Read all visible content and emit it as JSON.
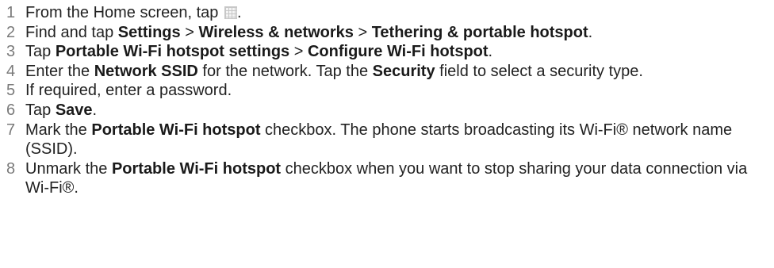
{
  "steps": [
    {
      "num": "1",
      "parts": [
        {
          "t": "From the Home screen, tap "
        },
        {
          "icon": "app-grid-icon"
        },
        {
          "t": "."
        }
      ]
    },
    {
      "num": "2",
      "parts": [
        {
          "t": "Find and tap "
        },
        {
          "b": "Settings"
        },
        {
          "t": " > "
        },
        {
          "b": "Wireless & networks"
        },
        {
          "t": " > "
        },
        {
          "b": "Tethering & portable hotspot"
        },
        {
          "t": "."
        }
      ]
    },
    {
      "num": "3",
      "parts": [
        {
          "t": "Tap "
        },
        {
          "b": "Portable Wi-Fi hotspot settings"
        },
        {
          "t": " > "
        },
        {
          "b": "Configure Wi-Fi hotspot"
        },
        {
          "t": "."
        }
      ]
    },
    {
      "num": "4",
      "parts": [
        {
          "t": "Enter the "
        },
        {
          "b": "Network SSID"
        },
        {
          "t": " for the network. Tap the "
        },
        {
          "b": "Security"
        },
        {
          "t": " field to select a security type."
        }
      ]
    },
    {
      "num": "5",
      "parts": [
        {
          "t": "If required, enter a password."
        }
      ]
    },
    {
      "num": "6",
      "parts": [
        {
          "t": "Tap "
        },
        {
          "b": "Save"
        },
        {
          "t": "."
        }
      ]
    },
    {
      "num": "7",
      "parts": [
        {
          "t": "Mark the "
        },
        {
          "b": "Portable Wi-Fi hotspot"
        },
        {
          "t": " checkbox. The phone starts broadcasting its Wi-Fi® network name (SSID)."
        }
      ]
    },
    {
      "num": "8",
      "parts": [
        {
          "t": "Unmark the "
        },
        {
          "b": "Portable Wi-Fi hotspot"
        },
        {
          "t": " checkbox when you want to stop sharing your data connection via Wi-Fi®."
        }
      ]
    }
  ]
}
